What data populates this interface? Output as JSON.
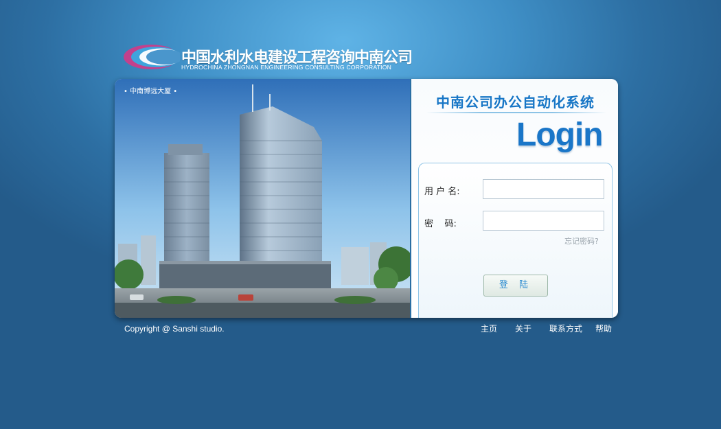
{
  "brand": {
    "name_cn": "中国水利水电建设工程咨询中南公司",
    "name_en": "HYDROCHINA ZHONGNAN ENGINEERING CONSULTING CORPORATION"
  },
  "photo": {
    "caption": "• 中南博远大厦 •"
  },
  "login": {
    "system_title": "中南公司办公自动化系统",
    "login_word": "Login",
    "username_label": "用 户 名:",
    "password_label": "密    码:",
    "username_value": "",
    "password_value": "",
    "forgot_link": "忘记密码?",
    "submit_label": "登 陆"
  },
  "footer": {
    "copyright": "Copyright @ Sanshi studio.",
    "nav": [
      "主页",
      "关于",
      "联系方式",
      "帮助"
    ]
  },
  "colors": {
    "accent": "#1776c6",
    "background": "#2d6fa3"
  }
}
